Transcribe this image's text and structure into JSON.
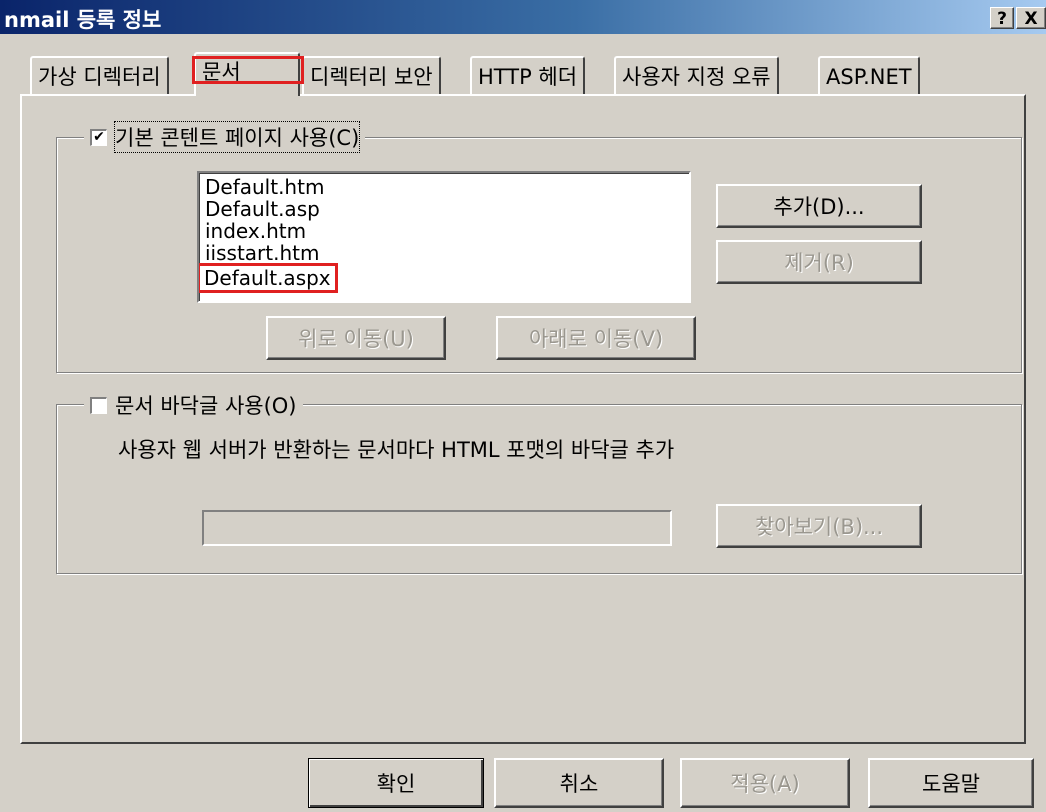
{
  "window": {
    "title": "nmail 등록 정보",
    "help_glyph": "?",
    "close_glyph": "X"
  },
  "tabs": [
    {
      "label": "가상 디렉터리"
    },
    {
      "label": "문서"
    },
    {
      "label": "디렉터리 보안"
    },
    {
      "label": "HTTP 헤더"
    },
    {
      "label": "사용자 지정 오류"
    },
    {
      "label": "ASP.NET"
    }
  ],
  "active_tab": "문서",
  "default_content": {
    "checkbox_label": "기본 콘텐트 페이지 사용(C)",
    "checked": true,
    "check_glyph": "✔",
    "documents": [
      "Default.htm",
      "Default.asp",
      "index.htm",
      "iisstart.htm",
      "Default.aspx"
    ],
    "add_button": "추가(D)...",
    "remove_button": "제거(R)",
    "move_up_button": "위로 이동(U)",
    "move_down_button": "아래로 이동(V)"
  },
  "footer": {
    "checkbox_label": "문서 바닥글 사용(O)",
    "checked": false,
    "description": "사용자 웹 서버가 반환하는 문서마다 HTML 포맷의 바닥글 추가",
    "path_value": "",
    "browse_button": "찾아보기(B)..."
  },
  "dialog_buttons": {
    "ok": "확인",
    "cancel": "취소",
    "apply": "적용(A)",
    "help": "도움말"
  },
  "highlight_color": "#e02020"
}
